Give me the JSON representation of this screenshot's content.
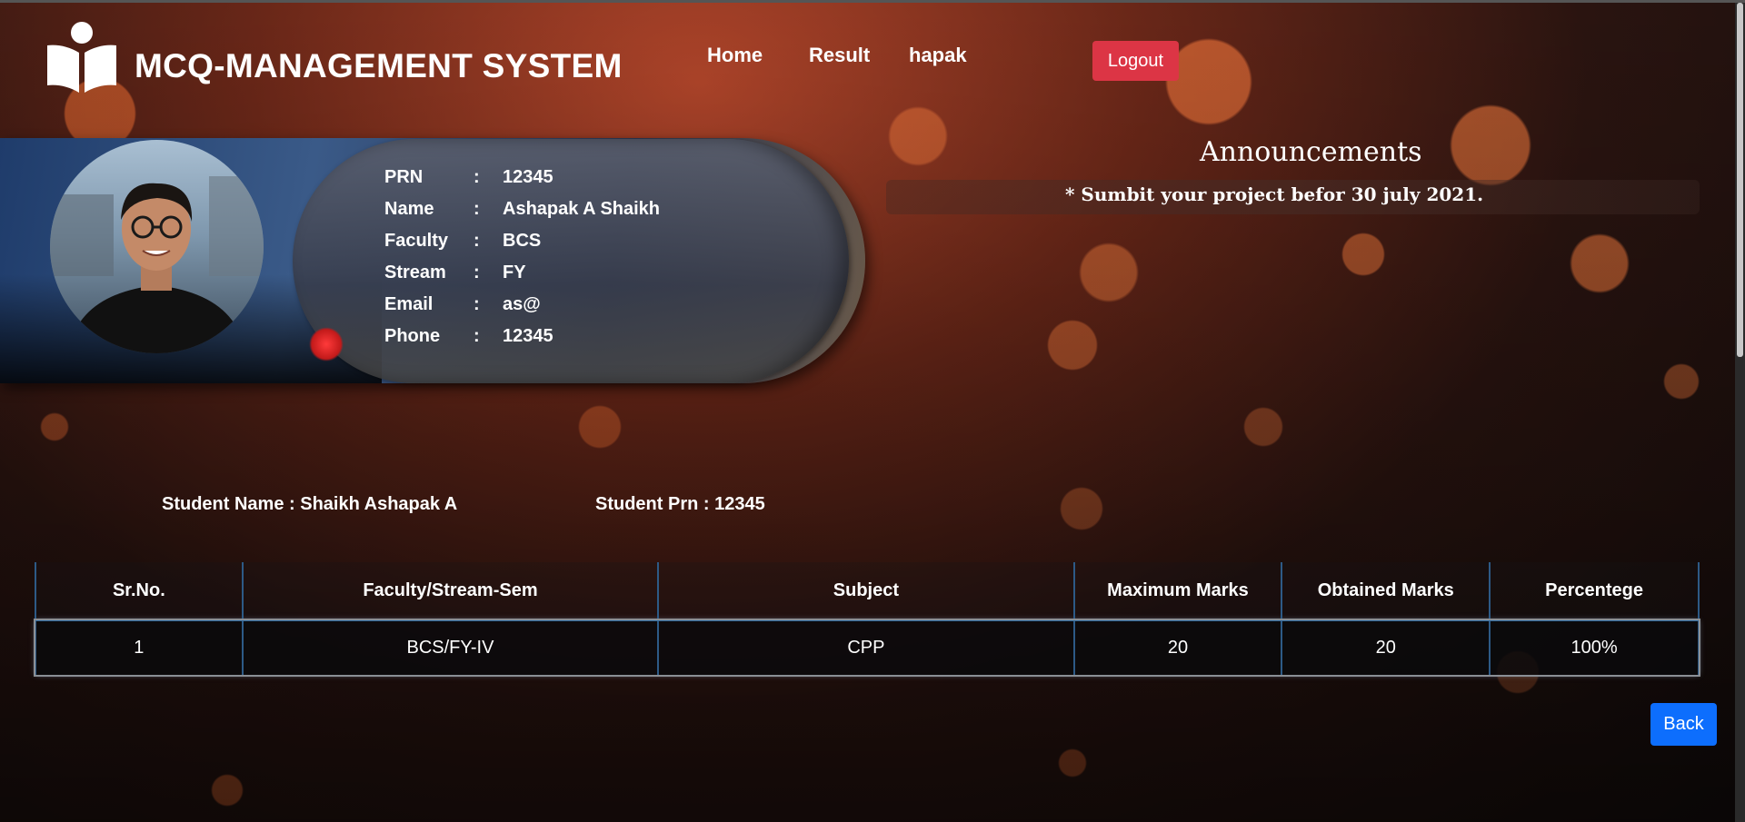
{
  "header": {
    "brand": "MCQ-MANAGEMENT SYSTEM",
    "nav": [
      "Home",
      "Result",
      "hapak"
    ],
    "logout_label": "Logout"
  },
  "profile": {
    "rows": [
      {
        "key": "PRN",
        "value": "12345"
      },
      {
        "key": "Name",
        "value": "Ashapak A Shaikh"
      },
      {
        "key": "Faculty",
        "value": "BCS"
      },
      {
        "key": "Stream",
        "value": "FY"
      },
      {
        "key": "Email",
        "value": "as@"
      },
      {
        "key": "Phone",
        "value": "12345"
      }
    ],
    "separator": ":"
  },
  "announcements": {
    "title": "Announcements",
    "items": [
      "* Sumbit your project befor 30 july 2021."
    ]
  },
  "student": {
    "name_label": "Student Name : Shaikh Ashapak A",
    "prn_label": "Student Prn : 12345"
  },
  "results": {
    "headers": [
      "Sr.No.",
      "Faculty/Stream-Sem",
      "Subject",
      "Maximum Marks",
      "Obtained Marks",
      "Percentege"
    ],
    "rows": [
      [
        "1",
        "BCS/FY-IV",
        "CPP",
        "20",
        "20",
        "100%"
      ]
    ]
  },
  "back_label": "Back",
  "colors": {
    "logout": "#dc3545",
    "back": "#0d6efd",
    "table_border": "#2d5a86"
  }
}
